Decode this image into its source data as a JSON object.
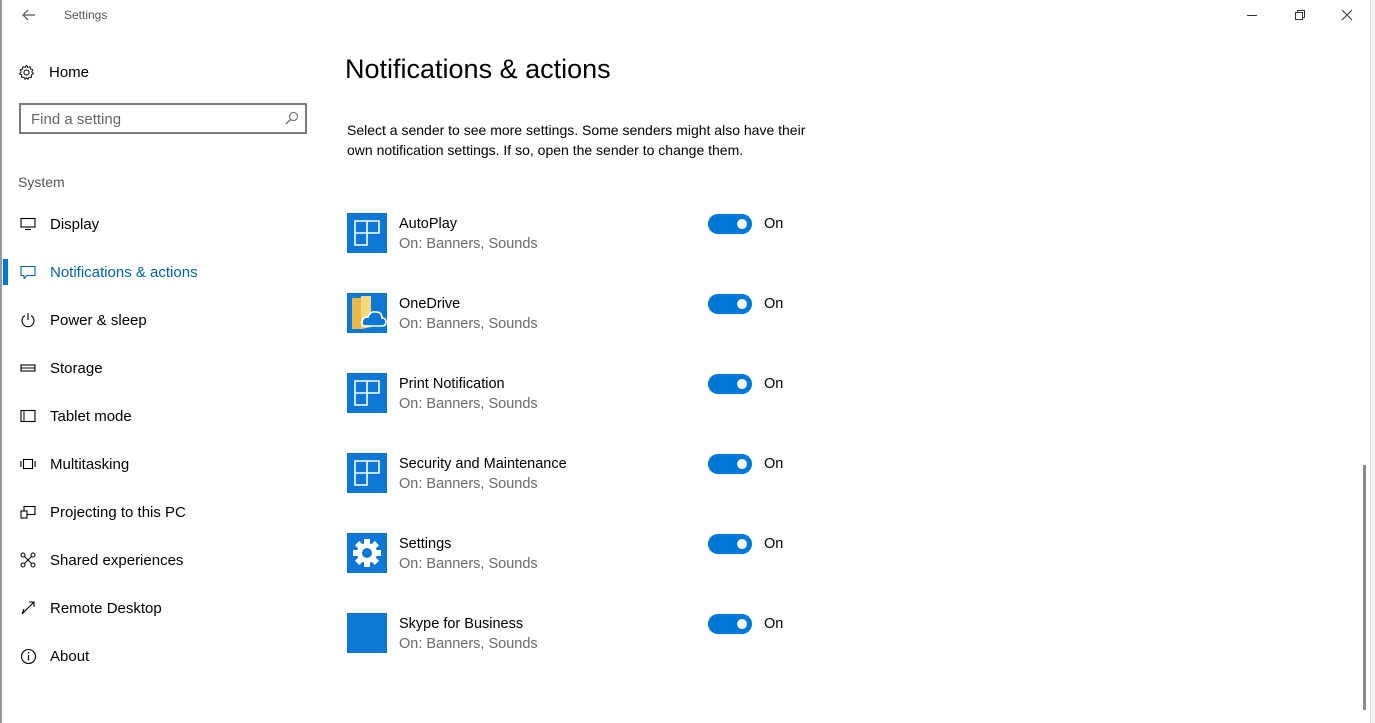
{
  "window": {
    "title": "Settings"
  },
  "sidebar": {
    "home_label": "Home",
    "search_placeholder": "Find a setting",
    "section_label": "System",
    "items": [
      {
        "label": "Display",
        "icon": "monitor-icon"
      },
      {
        "label": "Notifications & actions",
        "icon": "message-icon",
        "active": true
      },
      {
        "label": "Power & sleep",
        "icon": "power-icon"
      },
      {
        "label": "Storage",
        "icon": "storage-icon"
      },
      {
        "label": "Tablet mode",
        "icon": "tablet-icon"
      },
      {
        "label": "Multitasking",
        "icon": "multitasking-icon"
      },
      {
        "label": "Projecting to this PC",
        "icon": "projecting-icon"
      },
      {
        "label": "Shared experiences",
        "icon": "share-icon"
      },
      {
        "label": "Remote Desktop",
        "icon": "remote-desktop-icon"
      },
      {
        "label": "About",
        "icon": "info-icon"
      }
    ]
  },
  "main": {
    "title": "Notifications & actions",
    "description": "Select a sender to see more settings. Some senders might also have their own notification settings. If so, open the sender to change them.",
    "senders": [
      {
        "name": "AutoPlay",
        "status": "On: Banners, Sounds",
        "toggle": "On",
        "icon": "app-tile-icon"
      },
      {
        "name": "OneDrive",
        "status": "On: Banners, Sounds",
        "toggle": "On",
        "icon": "onedrive-folder-icon"
      },
      {
        "name": "Print Notification",
        "status": "On: Banners, Sounds",
        "toggle": "On",
        "icon": "app-tile-icon"
      },
      {
        "name": "Security and Maintenance",
        "status": "On: Banners, Sounds",
        "toggle": "On",
        "icon": "app-tile-icon"
      },
      {
        "name": "Settings",
        "status": "On: Banners, Sounds",
        "toggle": "On",
        "icon": "gear-icon"
      },
      {
        "name": "Skype for Business",
        "status": "On: Banners, Sounds",
        "toggle": "On",
        "icon": "skype-business-icon"
      }
    ]
  },
  "colors": {
    "accent": "#0078d7",
    "active_text": "#0063b1",
    "tile": "#0a78d4"
  }
}
